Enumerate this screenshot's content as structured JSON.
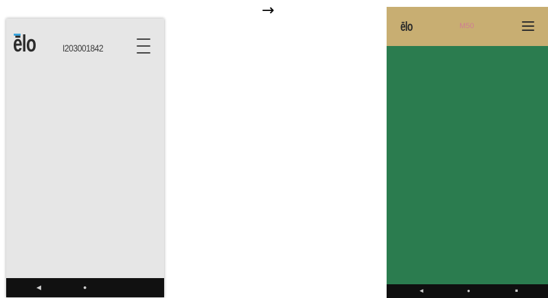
{
  "arrow": "→",
  "before": {
    "logo": "ēlo",
    "serial": "I203001842",
    "icons": {
      "menu": "hamburger-menu-icon",
      "back": "back-triangle-icon",
      "home": "home-circle-icon"
    },
    "nav": {
      "back": "◀",
      "home": "●"
    },
    "colors": {
      "screen": "#e6e6e6",
      "logo_accent": "#3ba4dc",
      "navbar": "#111111"
    }
  },
  "after": {
    "logo": "ēlo",
    "title": "M50",
    "icons": {
      "menu": "hamburger-menu-icon",
      "back": "back-triangle-icon",
      "home": "home-circle-icon",
      "recent": "recent-square-icon"
    },
    "nav": {
      "back": "◀",
      "home": "●",
      "recent": "■"
    },
    "colors": {
      "header": "#c8ae72",
      "body": "#2b7c4f",
      "title": "#cf7e92",
      "navbar": "#0f0f0f"
    }
  }
}
